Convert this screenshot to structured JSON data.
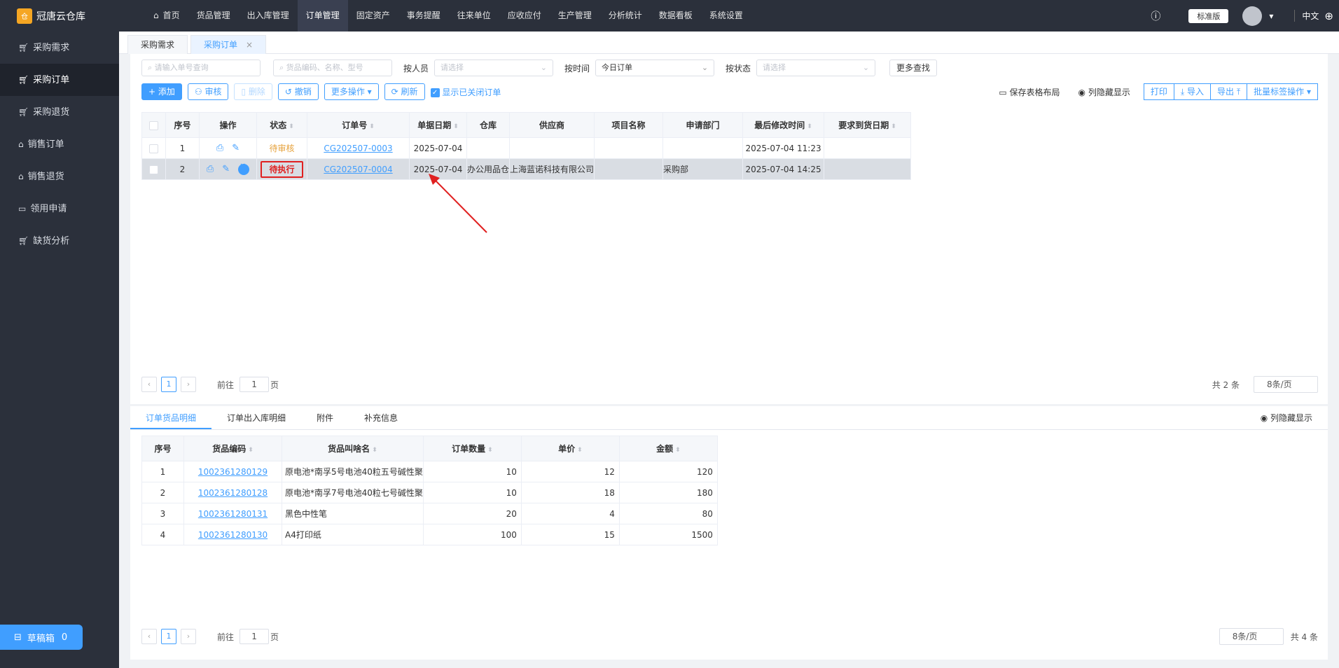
{
  "app": {
    "name": "冠唐云仓库",
    "logo_text": "仓"
  },
  "nav": [
    {
      "label": "首页",
      "icon": "home-icon"
    },
    {
      "label": "货品管理"
    },
    {
      "label": "出入库管理"
    },
    {
      "label": "订单管理",
      "active": true
    },
    {
      "label": "固定资产"
    },
    {
      "label": "事务提醒"
    },
    {
      "label": "往来单位"
    },
    {
      "label": "应收应付"
    },
    {
      "label": "生产管理"
    },
    {
      "label": "分析统计"
    },
    {
      "label": "数据看板"
    },
    {
      "label": "系统设置"
    }
  ],
  "topright": {
    "edition": "标准版",
    "lang": "中文"
  },
  "sidebar": [
    {
      "label": "采购需求",
      "icon": "cart-icon"
    },
    {
      "label": "采购订单",
      "icon": "cart-icon",
      "active": true
    },
    {
      "label": "采购退货",
      "icon": "cart-icon"
    },
    {
      "label": "销售订单",
      "icon": "bag-icon"
    },
    {
      "label": "销售退货",
      "icon": "bag-icon"
    },
    {
      "label": "领用申请",
      "icon": "briefcase-icon"
    },
    {
      "label": "缺货分析",
      "icon": "cart-icon"
    }
  ],
  "draft": {
    "label": "草稿箱",
    "count": "0"
  },
  "page_tabs": [
    {
      "label": "采购需求"
    },
    {
      "label": "采购订单",
      "active": true
    }
  ],
  "filters": {
    "order_placeholder": "请输入单号查询",
    "goods_placeholder": "货品编码、名称、型号",
    "person_label": "按人员",
    "person_placeholder": "请选择",
    "time_label": "按时间",
    "time_value": "今日订单",
    "status_label": "按状态",
    "status_placeholder": "请选择",
    "more_search": "更多查找"
  },
  "toolbar": {
    "add": "添加",
    "audit": "审核",
    "delete": "删除",
    "revoke": "撤销",
    "more": "更多操作",
    "refresh": "刷新",
    "show_closed": "显示已关闭订单",
    "save_layout": "保存表格布局",
    "col_hide": "列隐藏显示",
    "print": "打印",
    "import": "导入",
    "export": "导出",
    "batch_tag": "批量标签操作"
  },
  "orders": {
    "columns": [
      "序号",
      "操作",
      "状态",
      "订单号",
      "单据日期",
      "仓库",
      "供应商",
      "项目名称",
      "申请部门",
      "最后修改时间",
      "要求到货日期"
    ],
    "rows": [
      {
        "no": "1",
        "status": "待审核",
        "order_no": "CG202507-0003",
        "date": "2025-07-04",
        "warehouse": "",
        "supplier": "",
        "project": "",
        "dept": "",
        "modified": "2025-07-04 11:23",
        "due": ""
      },
      {
        "no": "2",
        "status": "待执行",
        "order_no": "CG202507-0004",
        "date": "2025-07-04",
        "warehouse": "办公用品仓",
        "supplier": "上海蓝诺科技有限公司",
        "project": "",
        "dept": "采购部",
        "modified": "2025-07-04 14:25",
        "due": "",
        "exec_badge": "执"
      }
    ],
    "pager": {
      "page": "1",
      "goto_label": "前往",
      "goto_value": "1",
      "page_unit": "页",
      "total": "共 2 条",
      "size": "8条/页"
    }
  },
  "bottom_tabs": [
    {
      "label": "订单货品明细",
      "active": true
    },
    {
      "label": "订单出入库明细"
    },
    {
      "label": "附件"
    },
    {
      "label": "补充信息"
    }
  ],
  "bottom_col_hide": "列隐藏显示",
  "details": {
    "columns": [
      "序号",
      "货品编码",
      "货品叫啥名",
      "订单数量",
      "单价",
      "金额"
    ],
    "rows": [
      {
        "no": "1",
        "code": "1002361280129",
        "name": "原电池*南孚5号电池40粒五号碱性聚",
        "qty": "10",
        "price": "12",
        "amount": "120"
      },
      {
        "no": "2",
        "code": "1002361280128",
        "name": "原电池*南孚7号电池40粒七号碱性聚",
        "qty": "10",
        "price": "18",
        "amount": "180"
      },
      {
        "no": "3",
        "code": "1002361280131",
        "name": "黑色中性笔",
        "qty": "20",
        "price": "4",
        "amount": "80"
      },
      {
        "no": "4",
        "code": "1002361280130",
        "name": "A4打印纸",
        "qty": "100",
        "price": "15",
        "amount": "1500"
      }
    ],
    "pager": {
      "page": "1",
      "goto_label": "前往",
      "goto_value": "1",
      "page_unit": "页",
      "total": "共 4 条",
      "size": "8条/页"
    }
  },
  "colors": {
    "accent": "#409eff",
    "sidebar": "#2b303b",
    "annotation": "#e02020",
    "pending": "#e6a23c"
  }
}
